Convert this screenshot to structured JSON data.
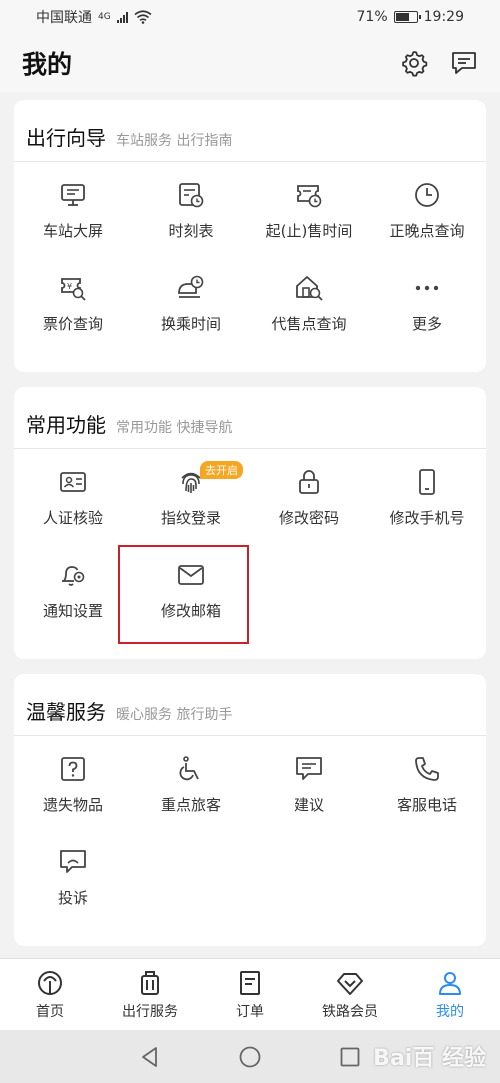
{
  "status": {
    "carrier": "中国联通",
    "network": "4G",
    "battery_pct": "71%",
    "battery_level": 0.71,
    "time": "19:29"
  },
  "header": {
    "title": "我的",
    "icons": [
      "gear-icon",
      "message-icon"
    ]
  },
  "sections": [
    {
      "title": "出行向导",
      "subtitle": "车站服务 出行指南",
      "items": [
        {
          "label": "车站大屏",
          "icon": "station-screen-icon"
        },
        {
          "label": "时刻表",
          "icon": "timetable-icon"
        },
        {
          "label": "起(止)售时间",
          "icon": "ticket-time-icon"
        },
        {
          "label": "正晚点查询",
          "icon": "clock-icon"
        },
        {
          "label": "票价查询",
          "icon": "fare-search-icon"
        },
        {
          "label": "换乘时间",
          "icon": "transfer-time-icon"
        },
        {
          "label": "代售点查询",
          "icon": "agency-search-icon"
        },
        {
          "label": "更多",
          "icon": "more-icon"
        }
      ]
    },
    {
      "title": "常用功能",
      "subtitle": "常用功能 快捷导航",
      "items": [
        {
          "label": "人证核验",
          "icon": "id-card-icon"
        },
        {
          "label": "指纹登录",
          "icon": "fingerprint-icon",
          "badge": "去开启"
        },
        {
          "label": "修改密码",
          "icon": "lock-icon"
        },
        {
          "label": "修改手机号",
          "icon": "phone-icon"
        },
        {
          "label": "通知设置",
          "icon": "bell-gear-icon"
        },
        {
          "label": "修改邮箱",
          "icon": "mail-icon"
        }
      ]
    },
    {
      "title": "温馨服务",
      "subtitle": "暖心服务 旅行助手",
      "items": [
        {
          "label": "遗失物品",
          "icon": "lost-item-icon"
        },
        {
          "label": "重点旅客",
          "icon": "wheelchair-icon"
        },
        {
          "label": "建议",
          "icon": "suggestion-icon"
        },
        {
          "label": "客服电话",
          "icon": "phone-call-icon"
        },
        {
          "label": "投诉",
          "icon": "complaint-icon"
        }
      ]
    }
  ],
  "tabbar": {
    "items": [
      {
        "label": "首页",
        "icon": "railway-logo-icon"
      },
      {
        "label": "出行服务",
        "icon": "luggage-icon"
      },
      {
        "label": "订单",
        "icon": "order-icon"
      },
      {
        "label": "铁路会员",
        "icon": "diamond-icon"
      },
      {
        "label": "我的",
        "icon": "person-icon",
        "active": true
      }
    ]
  },
  "watermark": "Bai百 经验",
  "colors": {
    "accent": "#2d8cf0",
    "badge": "#f5a623",
    "highlight": "#c8232c"
  }
}
